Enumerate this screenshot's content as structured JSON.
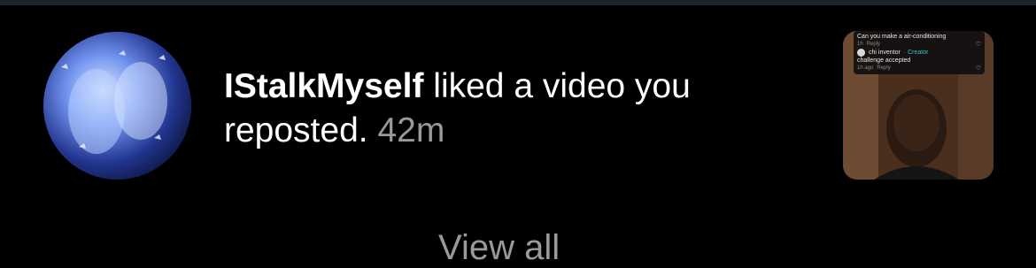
{
  "notification": {
    "username": "IStalkMyself",
    "action": " liked a video you reposted.",
    "time": "42m"
  },
  "thumbnail": {
    "comment_text": "Can you make a air-conditioning",
    "comment_meta": "1h",
    "reply_label": "Reply",
    "reply_author": "chi inventor",
    "creator_label": "· Creator",
    "reply_text": "challenge accepted",
    "reply_meta": "1h ago",
    "reply_reply_label": "Reply"
  },
  "footer": {
    "view_all_label": "View all"
  },
  "icons": {
    "avatar": "profile-avatar-image",
    "thumb": "video-thumbnail-image",
    "heart": "heart-icon"
  },
  "colors": {
    "background": "#000000",
    "secondary_text": "#9a9a9a",
    "creator_accent": "#39c0d3"
  }
}
